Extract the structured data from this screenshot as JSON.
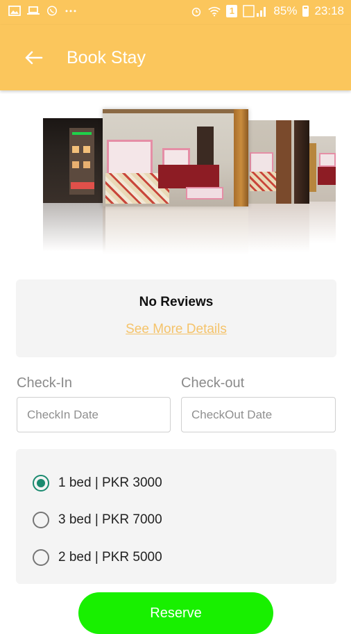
{
  "status_bar": {
    "battery": "85%",
    "time": "23:18",
    "sim_badge": "1",
    "left_icons": [
      "image-icon",
      "laptop-icon",
      "whatsapp-icon",
      "more-dots-icon"
    ],
    "right_icons": [
      "alarm-icon",
      "wifi-icon",
      "sim-badge",
      "signal-icon"
    ]
  },
  "app_bar": {
    "title": "Book Stay",
    "back_icon": "arrow-left-icon",
    "color": "#fbc65c"
  },
  "gallery": {
    "image_count": 4,
    "selected_index": 1
  },
  "reviews": {
    "title": "No Reviews",
    "link": "See More Details",
    "link_color": "#f5c36a"
  },
  "booking": {
    "checkin_label": "Check-In",
    "checkin_placeholder": "CheckIn Date",
    "checkin_value": "",
    "checkout_label": "Check-out",
    "checkout_placeholder": "CheckOut Date",
    "checkout_value": ""
  },
  "rooms": {
    "selected": 0,
    "options": [
      {
        "label": "1 bed | PKR 3000"
      },
      {
        "label": "3 bed | PKR 7000"
      },
      {
        "label": "2 bed | PKR 5000"
      }
    ],
    "accent_color": "#1a8a6f"
  },
  "reserve": {
    "label": "Reserve",
    "color": "#18f000"
  }
}
